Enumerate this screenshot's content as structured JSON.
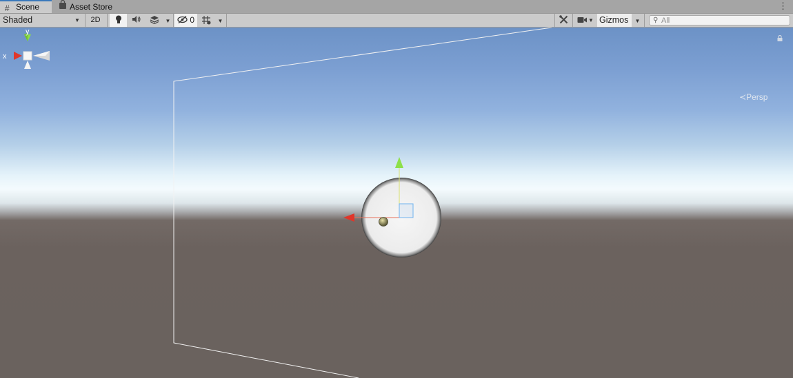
{
  "tabs": {
    "scene_label": "Scene",
    "store_label": "Asset Store",
    "scene_icon": "grid-icon",
    "store_icon": "shopping-bag-icon",
    "menu_icon": "kebab-menu-icon"
  },
  "toolbar": {
    "draw_mode": "Shaded",
    "mode_2d": "2D",
    "hidden_count": "0",
    "gizmos_label": "Gizmos",
    "search_placeholder": "All",
    "icons": [
      "lightbulb-icon",
      "speaker-icon",
      "layers-effects-icon",
      "hidden-eye-icon",
      "grid-snap-icon",
      "tools-icon",
      "camera-icon",
      "search-icon"
    ]
  },
  "viewport": {
    "view_mode_label": "Persp",
    "axis_x": "x",
    "axis_y": "y",
    "colors": {
      "sky_top": "#6c92c6",
      "horizon": "#f4fbfe",
      "ground": "#6a625e",
      "x_axis": "#e0362a",
      "y_axis": "#8ee04a",
      "sphere": "#f3f3f3",
      "camera_frustum": "#f0f0f0"
    }
  }
}
